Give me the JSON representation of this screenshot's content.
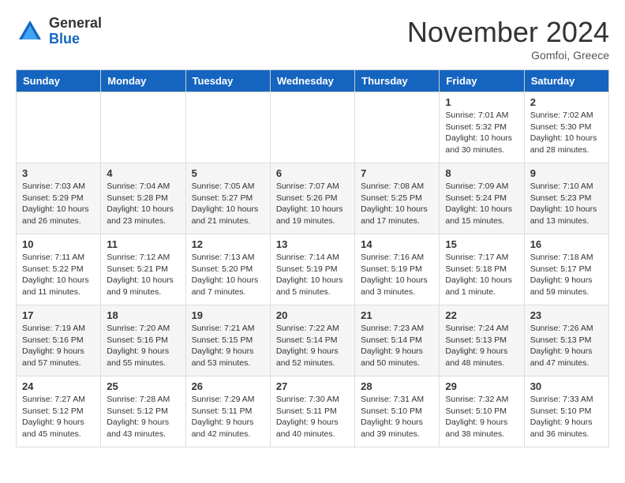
{
  "header": {
    "logo_line1": "General",
    "logo_line2": "Blue",
    "month": "November 2024",
    "location": "Gomfoi, Greece"
  },
  "weekdays": [
    "Sunday",
    "Monday",
    "Tuesday",
    "Wednesday",
    "Thursday",
    "Friday",
    "Saturday"
  ],
  "weeks": [
    [
      {
        "day": "",
        "info": ""
      },
      {
        "day": "",
        "info": ""
      },
      {
        "day": "",
        "info": ""
      },
      {
        "day": "",
        "info": ""
      },
      {
        "day": "",
        "info": ""
      },
      {
        "day": "1",
        "info": "Sunrise: 7:01 AM\nSunset: 5:32 PM\nDaylight: 10 hours\nand 30 minutes."
      },
      {
        "day": "2",
        "info": "Sunrise: 7:02 AM\nSunset: 5:30 PM\nDaylight: 10 hours\nand 28 minutes."
      }
    ],
    [
      {
        "day": "3",
        "info": "Sunrise: 7:03 AM\nSunset: 5:29 PM\nDaylight: 10 hours\nand 26 minutes."
      },
      {
        "day": "4",
        "info": "Sunrise: 7:04 AM\nSunset: 5:28 PM\nDaylight: 10 hours\nand 23 minutes."
      },
      {
        "day": "5",
        "info": "Sunrise: 7:05 AM\nSunset: 5:27 PM\nDaylight: 10 hours\nand 21 minutes."
      },
      {
        "day": "6",
        "info": "Sunrise: 7:07 AM\nSunset: 5:26 PM\nDaylight: 10 hours\nand 19 minutes."
      },
      {
        "day": "7",
        "info": "Sunrise: 7:08 AM\nSunset: 5:25 PM\nDaylight: 10 hours\nand 17 minutes."
      },
      {
        "day": "8",
        "info": "Sunrise: 7:09 AM\nSunset: 5:24 PM\nDaylight: 10 hours\nand 15 minutes."
      },
      {
        "day": "9",
        "info": "Sunrise: 7:10 AM\nSunset: 5:23 PM\nDaylight: 10 hours\nand 13 minutes."
      }
    ],
    [
      {
        "day": "10",
        "info": "Sunrise: 7:11 AM\nSunset: 5:22 PM\nDaylight: 10 hours\nand 11 minutes."
      },
      {
        "day": "11",
        "info": "Sunrise: 7:12 AM\nSunset: 5:21 PM\nDaylight: 10 hours\nand 9 minutes."
      },
      {
        "day": "12",
        "info": "Sunrise: 7:13 AM\nSunset: 5:20 PM\nDaylight: 10 hours\nand 7 minutes."
      },
      {
        "day": "13",
        "info": "Sunrise: 7:14 AM\nSunset: 5:19 PM\nDaylight: 10 hours\nand 5 minutes."
      },
      {
        "day": "14",
        "info": "Sunrise: 7:16 AM\nSunset: 5:19 PM\nDaylight: 10 hours\nand 3 minutes."
      },
      {
        "day": "15",
        "info": "Sunrise: 7:17 AM\nSunset: 5:18 PM\nDaylight: 10 hours\nand 1 minute."
      },
      {
        "day": "16",
        "info": "Sunrise: 7:18 AM\nSunset: 5:17 PM\nDaylight: 9 hours\nand 59 minutes."
      }
    ],
    [
      {
        "day": "17",
        "info": "Sunrise: 7:19 AM\nSunset: 5:16 PM\nDaylight: 9 hours\nand 57 minutes."
      },
      {
        "day": "18",
        "info": "Sunrise: 7:20 AM\nSunset: 5:16 PM\nDaylight: 9 hours\nand 55 minutes."
      },
      {
        "day": "19",
        "info": "Sunrise: 7:21 AM\nSunset: 5:15 PM\nDaylight: 9 hours\nand 53 minutes."
      },
      {
        "day": "20",
        "info": "Sunrise: 7:22 AM\nSunset: 5:14 PM\nDaylight: 9 hours\nand 52 minutes."
      },
      {
        "day": "21",
        "info": "Sunrise: 7:23 AM\nSunset: 5:14 PM\nDaylight: 9 hours\nand 50 minutes."
      },
      {
        "day": "22",
        "info": "Sunrise: 7:24 AM\nSunset: 5:13 PM\nDaylight: 9 hours\nand 48 minutes."
      },
      {
        "day": "23",
        "info": "Sunrise: 7:26 AM\nSunset: 5:13 PM\nDaylight: 9 hours\nand 47 minutes."
      }
    ],
    [
      {
        "day": "24",
        "info": "Sunrise: 7:27 AM\nSunset: 5:12 PM\nDaylight: 9 hours\nand 45 minutes."
      },
      {
        "day": "25",
        "info": "Sunrise: 7:28 AM\nSunset: 5:12 PM\nDaylight: 9 hours\nand 43 minutes."
      },
      {
        "day": "26",
        "info": "Sunrise: 7:29 AM\nSunset: 5:11 PM\nDaylight: 9 hours\nand 42 minutes."
      },
      {
        "day": "27",
        "info": "Sunrise: 7:30 AM\nSunset: 5:11 PM\nDaylight: 9 hours\nand 40 minutes."
      },
      {
        "day": "28",
        "info": "Sunrise: 7:31 AM\nSunset: 5:10 PM\nDaylight: 9 hours\nand 39 minutes."
      },
      {
        "day": "29",
        "info": "Sunrise: 7:32 AM\nSunset: 5:10 PM\nDaylight: 9 hours\nand 38 minutes."
      },
      {
        "day": "30",
        "info": "Sunrise: 7:33 AM\nSunset: 5:10 PM\nDaylight: 9 hours\nand 36 minutes."
      }
    ]
  ]
}
